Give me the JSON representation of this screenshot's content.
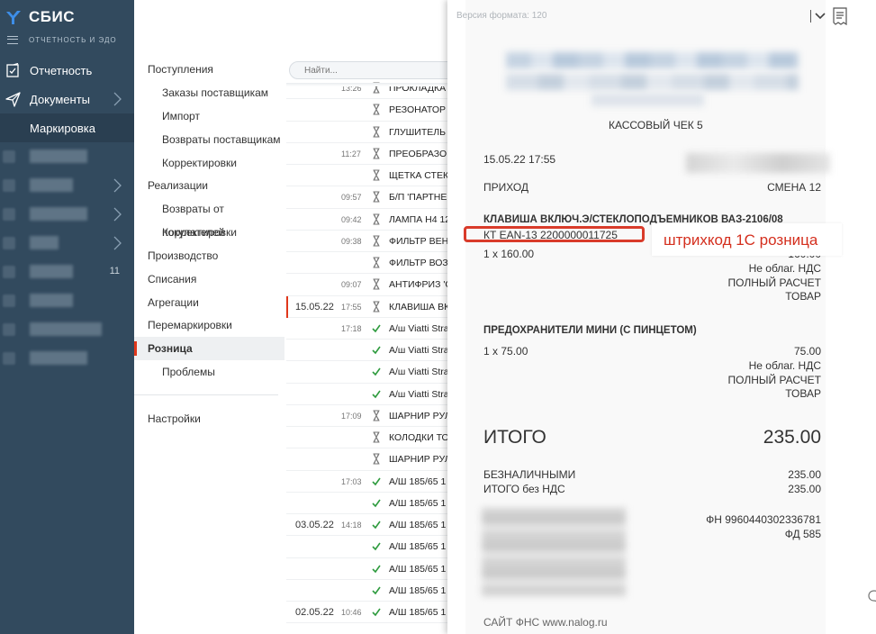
{
  "app": {
    "logo_text": "СБИС",
    "subtitle": "ОТЧЕТНОСТЬ И ЭДО"
  },
  "nav": {
    "reporting": "Отчетность",
    "documents": "Документы",
    "marking": "Маркировка",
    "blurred_count": "11"
  },
  "submenu": {
    "items": [
      {
        "label": "Поступления"
      },
      {
        "label": "Заказы поставщикам"
      },
      {
        "label": "Импорт"
      },
      {
        "label": "Возвраты поставщикам"
      },
      {
        "label": "Корректировки"
      },
      {
        "label": "Реализации"
      },
      {
        "label": "Возвраты от покупателей"
      },
      {
        "label": "Корректировки"
      },
      {
        "label": "Производство"
      },
      {
        "label": "Списания"
      },
      {
        "label": "Агрегации"
      },
      {
        "label": "Перемаркировки"
      },
      {
        "label": "Розница"
      },
      {
        "label": "Проблемы"
      }
    ],
    "settings": "Настройки"
  },
  "list": {
    "search_placeholder": "Найти...",
    "rows": [
      {
        "date": "",
        "time": "13:26",
        "status": "pending",
        "name": "ПРОКЛАДКА Ф"
      },
      {
        "date": "",
        "time": "",
        "status": "pending",
        "name": "РЕЗОНАТОР Д"
      },
      {
        "date": "",
        "time": "",
        "status": "pending",
        "name": "ГЛУШИТЕЛЬ К"
      },
      {
        "date": "",
        "time": "11:27",
        "status": "pending",
        "name": "ПРЕОБРАЗОВА"
      },
      {
        "date": "",
        "time": "",
        "status": "pending",
        "name": "ЩЕТКА СТЕКЛ"
      },
      {
        "date": "",
        "time": "09:57",
        "status": "pending",
        "name": "Б/П 'ПАРТНЕР"
      },
      {
        "date": "",
        "time": "09:42",
        "status": "pending",
        "name": "ЛАМПА Н4 12"
      },
      {
        "date": "",
        "time": "09:38",
        "status": "pending",
        "name": "ФИЛЬТР ВЕНТ"
      },
      {
        "date": "",
        "time": "",
        "status": "pending",
        "name": "ФИЛЬТР ВОЗД"
      },
      {
        "date": "",
        "time": "09:07",
        "status": "pending",
        "name": "АНТИФРИЗ 'С"
      },
      {
        "date": "15.05.22",
        "time": "17:55",
        "status": "pending",
        "name": "КЛАВИША ВК"
      },
      {
        "date": "",
        "time": "17:18",
        "status": "done",
        "name": "А/ш Viatti Stra"
      },
      {
        "date": "",
        "time": "",
        "status": "done",
        "name": "А/ш Viatti Stra"
      },
      {
        "date": "",
        "time": "",
        "status": "done",
        "name": "А/ш Viatti Stra"
      },
      {
        "date": "",
        "time": "",
        "status": "done",
        "name": "А/ш Viatti Stra"
      },
      {
        "date": "",
        "time": "17:09",
        "status": "pending",
        "name": "ШАРНИР РУЛ"
      },
      {
        "date": "",
        "time": "",
        "status": "pending",
        "name": "КОЛОДКИ ТО"
      },
      {
        "date": "",
        "time": "",
        "status": "pending",
        "name": "ШАРНИР РУЛ"
      },
      {
        "date": "",
        "time": "17:03",
        "status": "done",
        "name": "А/Ш 185/65 1"
      },
      {
        "date": "",
        "time": "",
        "status": "done",
        "name": "А/Ш 185/65 1"
      },
      {
        "date": "03.05.22",
        "time": "14:18",
        "status": "done",
        "name": "А/Ш 185/65 1"
      },
      {
        "date": "",
        "time": "",
        "status": "done",
        "name": "А/Ш 185/65 1"
      },
      {
        "date": "",
        "time": "",
        "status": "done",
        "name": "А/Ш 185/65 1"
      },
      {
        "date": "",
        "time": "",
        "status": "done",
        "name": "А/Ш 185/65 1"
      },
      {
        "date": "02.05.22",
        "time": "10:46",
        "status": "done",
        "name": "А/Ш 185/65 1"
      }
    ]
  },
  "receipt": {
    "format_version": "Версия формата: 120",
    "title": "КАССОВЫЙ ЧЕК 5",
    "datetime": "15.05.22 17:55",
    "operation": "ПРИХОД",
    "shift": "СМЕНА 12",
    "item1": {
      "name": "КЛАВИША ВКЛЮЧ.Э/СТЕКЛОПОДЪЕМНИКОВ ВАЗ-2106/08",
      "code": "КТ EAN-13 2200000011725",
      "qty": "1 x 160.00",
      "price": "160.00",
      "vat": "Не облаг. НДС",
      "payment": "ПОЛНЫЙ РАСЧЕТ",
      "kind": "ТОВАР"
    },
    "item2": {
      "name": "ПРЕДОХРАНИТЕЛИ МИНИ (С ПИНЦЕТОМ)",
      "qty": "1 x 75.00",
      "price": "75.00",
      "vat": "Не облаг. НДС",
      "payment": "ПОЛНЫЙ РАСЧЕТ",
      "kind": "ТОВАР"
    },
    "total_label": "ИТОГО",
    "total_value": "235.00",
    "cashless_label": "БЕЗНАЛИЧНЫМИ",
    "cashless_value": "235.00",
    "novat_label": "ИТОГО без НДС",
    "novat_value": "235.00",
    "fn": "ФН 9960440302336781",
    "fd": "ФД 585",
    "site": "САЙТ ФНС www.nalog.ru"
  },
  "annotation": {
    "callout": "штрихкод 1С розница"
  },
  "colors": {
    "sidebar": "#324a5e",
    "accent_red": "#d93b2a",
    "check_green": "#2e9b3e"
  }
}
